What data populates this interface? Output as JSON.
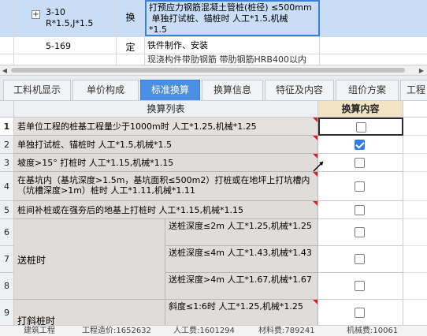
{
  "quota_rows": [
    {
      "code_line1": "3-10",
      "code_line2": "R*1.5,J*1.5",
      "type": "换",
      "name": "打预应力钢筋混凝土管桩(桩径) ≤500mm\n 单独打试桩、锚桩时 人工*1.5,机械\n*1.5",
      "selected": true
    },
    {
      "code": "5-169",
      "type": "定",
      "name": "铁件制作、安装"
    },
    {
      "code": "",
      "type": "",
      "name": "现浇构件带肋钢筋 带肋钢筋HRB400以内"
    }
  ],
  "tabs": [
    {
      "label": "工料机显示"
    },
    {
      "label": "单价构成"
    },
    {
      "label": "标准换算",
      "active": true
    },
    {
      "label": "换算信息"
    },
    {
      "label": "特征及内容"
    },
    {
      "label": "组价方案"
    },
    {
      "label": "工程"
    }
  ],
  "conversion": {
    "col_list": "换算列表",
    "col_content": "换算内容",
    "rows": [
      {
        "num": "1",
        "text": "若单位工程的桩基工程量少于1000m时 人工*1.25,机械*1.25",
        "checked": false,
        "current": true
      },
      {
        "num": "2",
        "text": "单独打试桩、锚桩时 人工*1.5,机械*1.5",
        "checked": true
      },
      {
        "num": "3",
        "text": "坡度>15° 打桩时 人工*1.15,机械*1.15",
        "checked": false
      },
      {
        "num": "4",
        "text": "在基坑内（基坑深度>1.5m，基坑面积≤500m2）打桩或在地坪上打坑槽内（坑槽深度>1m）桩时 人工*1.11,机械*1.11",
        "checked": false
      },
      {
        "num": "5",
        "text": "桩间补桩或在强夯后的地基上打桩时 人工*1.15,机械*1.15",
        "checked": false
      },
      {
        "num": "6",
        "sub": "送桩深度≤2m 人工*1.25,机械*1.25",
        "checked": false
      },
      {
        "num": "7",
        "group": "送桩时",
        "sub": "送桩深度≤4m 人工*1.43,机械*1.43",
        "checked": false
      },
      {
        "num": "8",
        "sub": "送桩深度>4m 人工*1.67,机械*1.67",
        "checked": false
      },
      {
        "num": "9",
        "group": "打斜桩时",
        "sub": "斜度≤1:6时 人工*1.25,机械*1.25",
        "checked": false
      }
    ]
  },
  "statusbar": {
    "item1": "建筑工程",
    "item2": "工程造价:1652632",
    "item3": "人工费:1601294",
    "item4": "材料费:789241",
    "item5": "机械费:10061"
  },
  "icons": {
    "expander": "expand-plus-icon",
    "cursor": "mouse-cursor-icon"
  }
}
